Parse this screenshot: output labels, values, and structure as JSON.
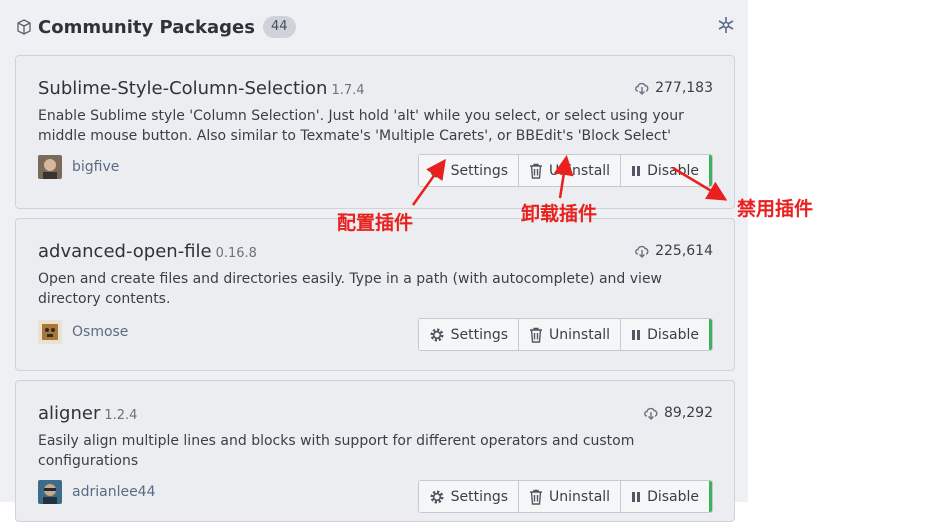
{
  "header": {
    "title": "Community Packages",
    "count": "44"
  },
  "packages": [
    {
      "name": "Sublime-Style-Column-Selection",
      "version": "1.7.4",
      "downloads": "277,183",
      "description": "Enable Sublime style 'Column Selection'. Just hold 'alt' while you select, or select using your middle mouse button. Also similar to Texmate's 'Multiple Carets', or BBEdit's 'Block Select'",
      "author": "bigfive",
      "buttons": {
        "settings": "Settings",
        "uninstall": "Uninstall",
        "disable": "Disable"
      }
    },
    {
      "name": "advanced-open-file",
      "version": "0.16.8",
      "downloads": "225,614",
      "description": "Open and create files and directories easily. Type in a path (with autocomplete) and view directory contents.",
      "author": "Osmose",
      "buttons": {
        "settings": "Settings",
        "uninstall": "Uninstall",
        "disable": "Disable"
      }
    },
    {
      "name": "aligner",
      "version": "1.2.4",
      "downloads": "89,292",
      "description": "Easily align multiple lines and blocks with support for different operators and custom configurations",
      "author": "adrianlee44",
      "buttons": {
        "settings": "Settings",
        "uninstall": "Uninstall",
        "disable": "Disable"
      }
    }
  ],
  "annotations": {
    "settings": "配置插件",
    "uninstall": "卸载插件",
    "disable": "禁用插件"
  },
  "colors": {
    "annotation": "#e8201e",
    "enabled_bar": "#3bb25b"
  }
}
